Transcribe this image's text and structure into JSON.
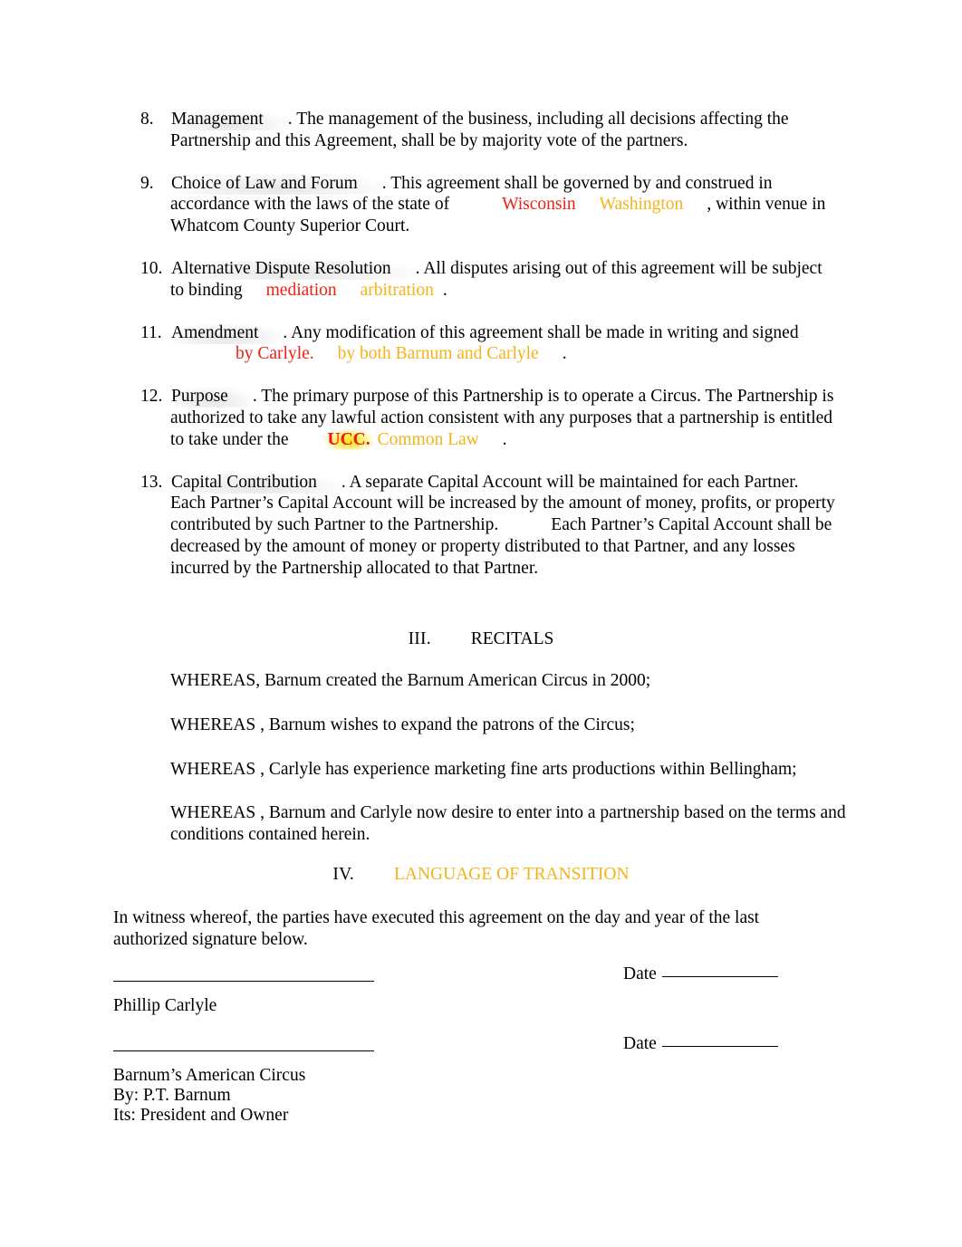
{
  "document": {
    "clauses": [
      {
        "number": "8.",
        "lead": "Management",
        "text_1": ". The management of the business, including all decisions affecting the Partnership and this Agreement, shall be by majority vote of the partners."
      },
      {
        "number": "9.",
        "lead": "Choice of Law and Forum",
        "text_1": ". This agreement shall be governed by and construed in accordance with the laws of the state of",
        "deleted": "Wisconsin",
        "inserted": "Washington",
        "text_2": ", within venue in Whatcom County Superior Court."
      },
      {
        "number": "10.",
        "lead": "Alternative Dispute Resolution",
        "text_1": ". All disputes arising out of this agreement will be subject to binding",
        "deleted": "mediation",
        "inserted": "arbitration",
        "text_2": "."
      },
      {
        "number": "11.",
        "lead": "Amendment",
        "text_1": ". Any modification of this agreement shall be made in writing and signed",
        "deleted": "by Carlyle.",
        "inserted": "by both Barnum and Carlyle",
        "text_2": "."
      },
      {
        "number": "12.",
        "lead": "Purpose",
        "text_1": ". The primary purpose of this Partnership is to operate a Circus. The Partnership is authorized to take any lawful action consistent with any purposes that a partnership is entitled to take under the",
        "deleted": "UCC.",
        "inserted": "Common Law",
        "text_2": "."
      },
      {
        "number": "13.",
        "lead": "Capital Contribution",
        "text_1": ". A separate Capital Account will be maintained for each Partner. Each Partner’s Capital Account will be increased by the amount of money, profits, or property contributed by such Partner to the Partnership.",
        "text_2": "Each Partner’s Capital Account shall be decreased by the amount of money or property distributed to that Partner, and any losses incurred by the Partnership allocated to that Partner."
      }
    ],
    "section_recitals": {
      "numeral": "III.",
      "title": "RECITALS"
    },
    "whereas": [
      "WHEREAS,  Barnum created the Barnum American Circus in 2000;",
      "WHEREAS , Barnum wishes to expand the patrons of the Circus;",
      "WHEREAS , Carlyle has experience marketing fine arts productions within Bellingham;",
      "WHEREAS , Barnum and Carlyle now desire to enter into a partnership based on the terms and conditions contained herein."
    ],
    "section_transition": {
      "numeral": "IV.",
      "title": "LANGUAGE OF TRANSITION"
    },
    "witness_statement": "In witness whereof, the parties have executed this agreement on the day and year of the last authorized signature below.",
    "signatures": [
      {
        "date_label": "Date",
        "name_lines": [
          "Phillip Carlyle"
        ]
      },
      {
        "date_label": "Date",
        "name_lines": [
          "Barnum’s American Circus",
          "By: P.T. Barnum",
          "Its: President and Owner"
        ]
      }
    ]
  },
  "colors": {
    "deleted_text": "#ee2211",
    "inserted_text": "#f5b21a",
    "highlight_yellow": "#ffe200",
    "body_text": "#000000",
    "page_background": "#ffffff"
  }
}
